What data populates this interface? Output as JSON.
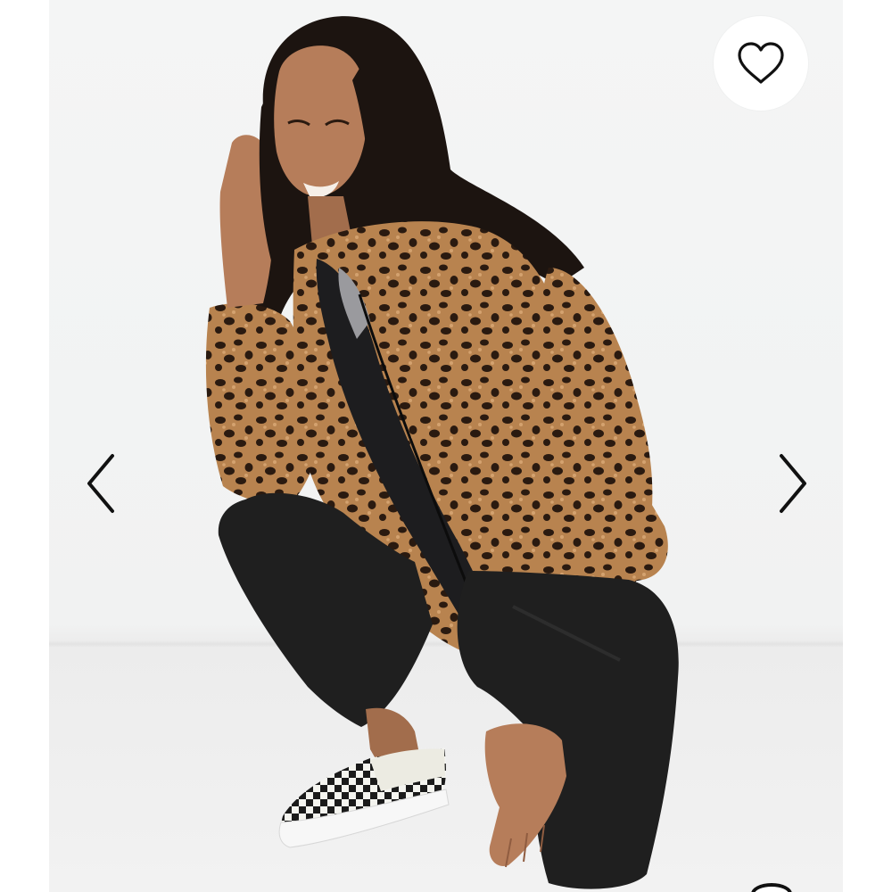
{
  "product_image": {
    "alt": "",
    "colors": {
      "backdrop": "#f2f3f3",
      "jacket_base": "#b8834f",
      "jacket_spots": "#2a1a10",
      "pants": "#1f1f1f",
      "skin": "#b67d5a",
      "hair": "#1c1410"
    }
  },
  "controls": {
    "favorite_icon": "heart-outline-icon",
    "prev_icon": "chevron-left-icon",
    "next_icon": "chevron-right-icon",
    "carousel_indicator_icon": "dot-indicator-icon"
  }
}
